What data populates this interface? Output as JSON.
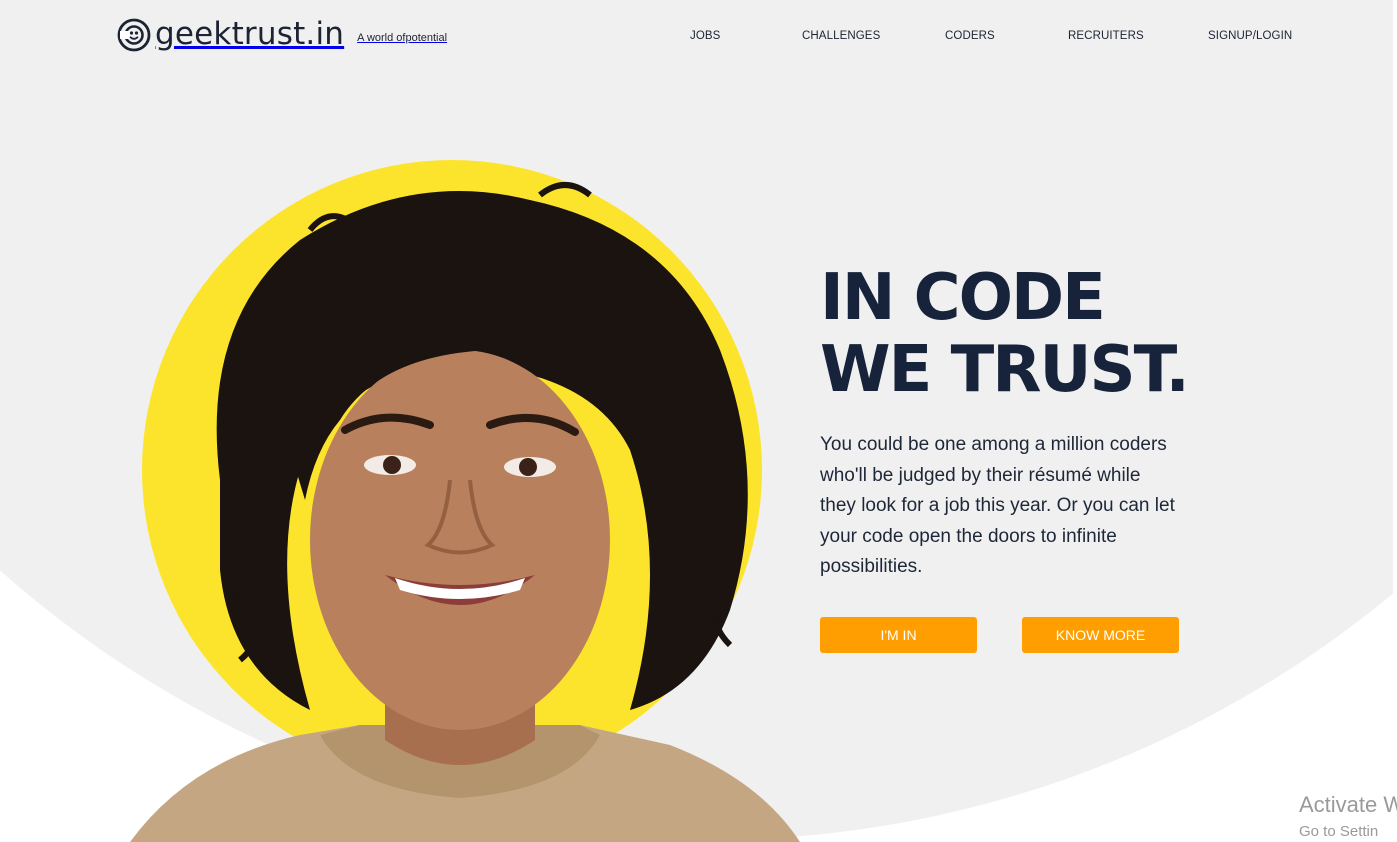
{
  "brand": {
    "name": "geektrust.in",
    "tagline": "A world ofpotential"
  },
  "nav": [
    {
      "label": "JOBS"
    },
    {
      "label": "CHALLENGES"
    },
    {
      "label": "CODERS"
    },
    {
      "label": "RECRUITERS"
    },
    {
      "label": "SIGNUP/LOGIN"
    }
  ],
  "hero": {
    "headline_line1": "IN CODE",
    "headline_line2": "WE TRUST.",
    "body": "You could be one among a million coders who'll be judged by their résumé while they look for a job this year. Or you can let your code open the doors to infinite possibilities.",
    "primary_button": "I'M IN",
    "secondary_button": "KNOW MORE"
  },
  "watermark": {
    "title": "Activate W",
    "subtitle": "Go to Settin"
  },
  "colors": {
    "accent_yellow": "#fde42c",
    "button_orange": "#ff9e00",
    "headline_navy": "#16233a",
    "background_gray": "#f0f0f0"
  },
  "icons": {
    "logo": "smiley-face-logo-icon"
  }
}
